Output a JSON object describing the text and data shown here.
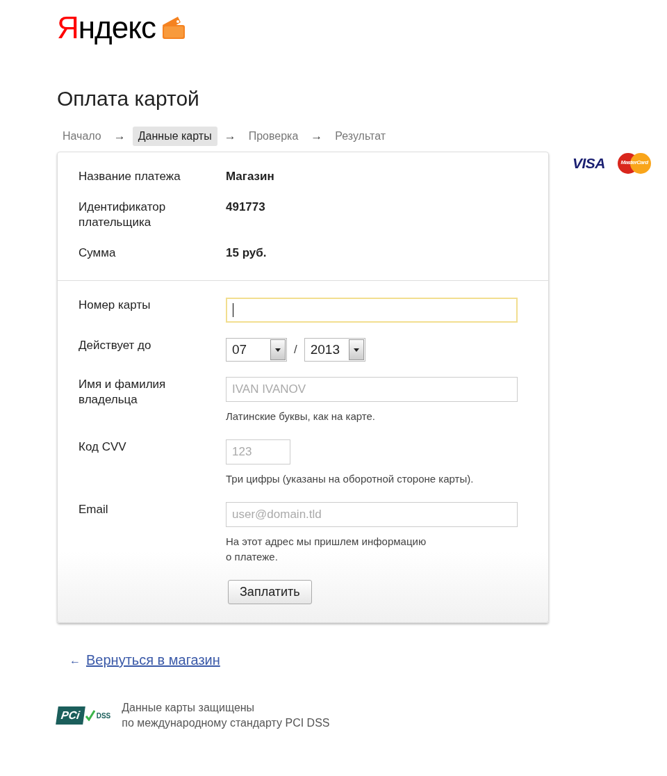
{
  "logo": {
    "text": "Яндекс"
  },
  "title": "Оплата картой",
  "steps": [
    {
      "label": "Начало",
      "selected": false
    },
    {
      "arrow": "→",
      "label": "Данные карты",
      "selected": true
    },
    {
      "arrow": "→",
      "label": "Проверка",
      "selected": false
    },
    {
      "arrow": "→",
      "label": "Результат",
      "selected": false
    }
  ],
  "summary": [
    {
      "label": "Название платежа",
      "value": "Магазин"
    },
    {
      "label": "Идентификатор\nплательщика",
      "value": "491773"
    },
    {
      "label": "Сумма",
      "value": "15 руб."
    }
  ],
  "card_brands": [
    {
      "kind": "visa",
      "text": "VISA"
    },
    {
      "kind": "mastercard",
      "text": "MasterCard"
    }
  ],
  "form": {
    "card_number": {
      "label": "Номер карты",
      "focused": true
    },
    "expiry": {
      "label": "Действует до",
      "month": "07",
      "separator": "/",
      "year": "2013"
    },
    "holder": {
      "label": "Имя и фамилия\nвладельца",
      "placeholder": "IVAN IVANOV",
      "hint": "Латинские буквы, как на карте."
    },
    "cvv": {
      "label": "Код CVV",
      "placeholder": "123",
      "hint": "Три цифры (указаны на оборотной стороне карты)."
    },
    "email": {
      "label": "Email",
      "placeholder": "user@domain.tld",
      "hint": "На этот адрес мы пришлем информацию\nо платеже."
    },
    "submit": "Заплатить"
  },
  "back_link": {
    "arrow": "←",
    "label": "Вернуться в магазин"
  },
  "security": {
    "badge_pci": "PCi",
    "badge_dss": "DSS",
    "text": "Данные карты защищены\nпо международному стандарту PCI DSS"
  }
}
